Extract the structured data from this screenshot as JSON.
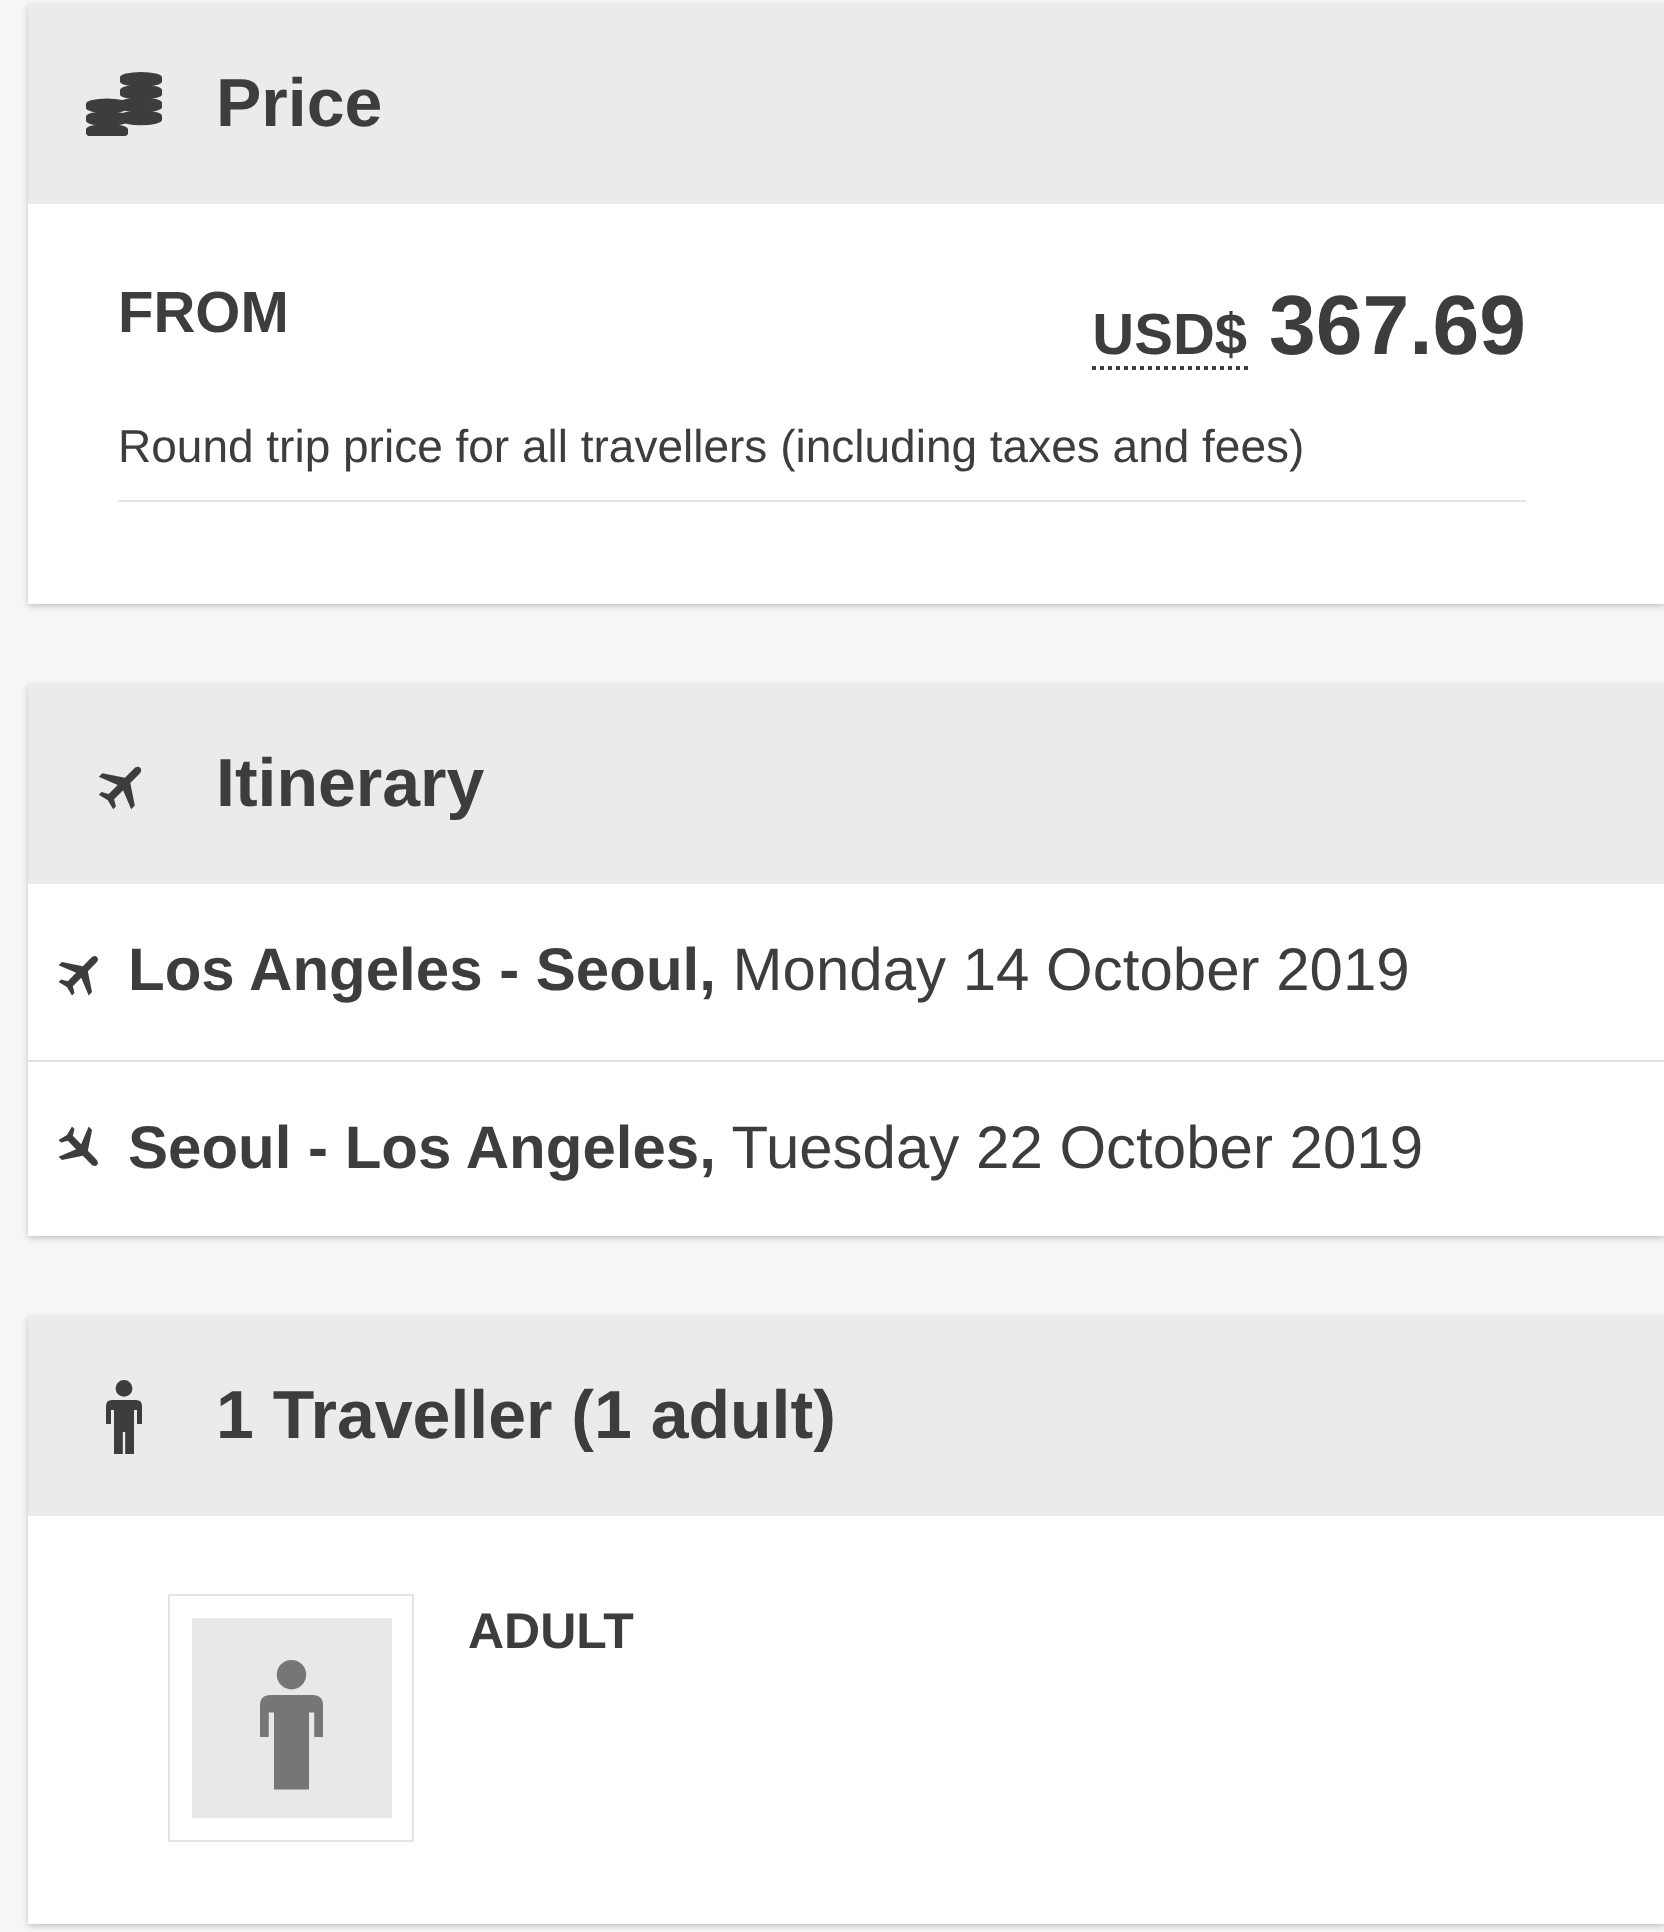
{
  "price": {
    "title": "Price",
    "label": "FROM",
    "currency": "USD$",
    "amount": "367.69",
    "note": "Round trip price for all travellers (including taxes and fees)"
  },
  "itinerary": {
    "title": "Itinerary",
    "legs": [
      {
        "kind": "departure",
        "text": "**Los Angeles - Seoul,** Monday 14 October 2019"
      },
      {
        "kind": "return",
        "text": "**Seoul - Los Angeles,** Tuesday 22 October 2019"
      }
    ]
  },
  "travellers": {
    "title": "1 Traveller (1 adult)",
    "people": [
      {
        "label": "ADULT"
      }
    ]
  }
}
